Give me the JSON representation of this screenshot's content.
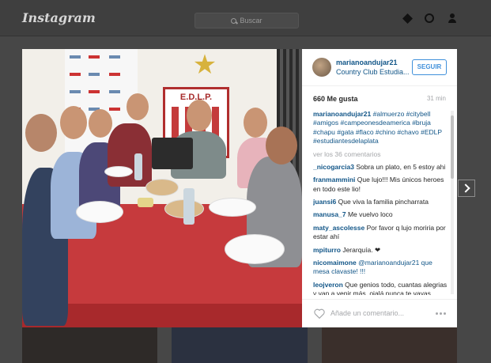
{
  "nav": {
    "logo": "Instagram",
    "search_placeholder": "Buscar"
  },
  "post": {
    "username": "marianoandujar21",
    "location": "Country Club Estudia...",
    "follow_label": "SEGUIR",
    "likes": "660 Me gusta",
    "time": "31 min",
    "caption_user": "marianoandujar21",
    "caption_text": "#almuerzo #citybell #amigos #campeonesdeamerica #bruja #chapu #gata #flaco #chino #chavo #EDLP #estudiantesdelaplata",
    "view_all": "ver los 36 comentarios",
    "comments": [
      {
        "user": "_nicogarcia3",
        "text": "Sobra un plato, en 5 estoy ahi"
      },
      {
        "user": "franmammini",
        "text": "Que lujo!!! Mis únicos heroes en todo este lio!"
      },
      {
        "user": "juansi6",
        "text": "Que viva la familia pincharrata"
      },
      {
        "user": "manusa_7",
        "text": "Me vuelvo loco"
      },
      {
        "user": "maty_ascolesse",
        "text": "Por favor q lujo moriria por estar ahí"
      },
      {
        "user": "mpiturro",
        "text": "Jerarquía. ❤"
      },
      {
        "user": "nicomaimone",
        "text": "@marianoandujar21 que mesa clavaste! !!!"
      },
      {
        "user": "leojveron",
        "text": "Que genios todo, cuantas alegrias y van a venir más, ojalá nunca te vayas Mariano se te quiere, saludos para"
      }
    ],
    "comment_placeholder": "Añade un comentario..."
  },
  "photo": {
    "crest_text": "E.D.L.P."
  }
}
